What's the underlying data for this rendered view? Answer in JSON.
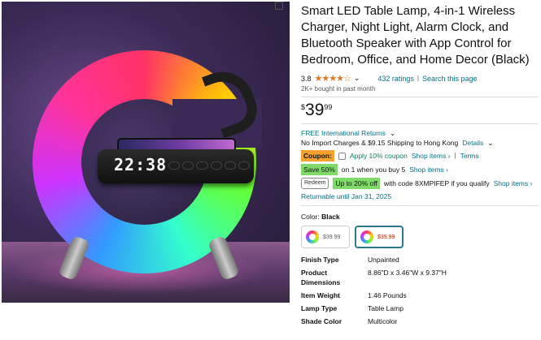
{
  "image": {
    "clock_text": "22:38",
    "alt_icon": "share-icon"
  },
  "product": {
    "title": "Smart LED Table Lamp, 4-in-1 Wireless Charger, Night Light, Alarm Clock, and Bluetooth Speaker with App Control for Bedroom, Office, and Home Decor (Black)",
    "rating_value": "3.8",
    "stars": "★★★★☆",
    "ratings_count": "432 ratings",
    "separator": "|",
    "search_page": "Search this page",
    "bought": "2K+ bought in past month",
    "price": {
      "symbol": "$",
      "whole": "39",
      "fraction": "99"
    },
    "returns": "FREE International Returns",
    "import": "No Import Charges & $9.15 Shipping to Hong Kong",
    "details": "Details",
    "coupon": {
      "badge": "Coupon:",
      "text": "Apply 10% coupon",
      "shop": "Shop items ›",
      "sep": "|",
      "terms": "Terms"
    },
    "save": {
      "badge": "Save 50%",
      "text": "on 1 when you buy 5",
      "shop": "Shop items ›"
    },
    "redeem": {
      "badge": "Redeem",
      "offer": "Up to 20% off",
      "text": "with code 8XMPIFEP if you qualify",
      "shop": "Shop items ›"
    },
    "returnable": "Returnable until Jan 31, 2025",
    "color": {
      "label": "Color:",
      "value": "Black"
    },
    "swatches": [
      {
        "price": "$39.99"
      },
      {
        "price": "$39.99"
      }
    ],
    "specs": [
      {
        "k": "Finish Type",
        "v": "Unpainted"
      },
      {
        "k": "Product Dimensions",
        "v": "8.86\"D x 3.46\"W x 9.37\"H"
      },
      {
        "k": "Item Weight",
        "v": "1.46 Pounds"
      },
      {
        "k": "Lamp Type",
        "v": "Table Lamp"
      },
      {
        "k": "Shade Color",
        "v": "Multicolor"
      }
    ]
  }
}
